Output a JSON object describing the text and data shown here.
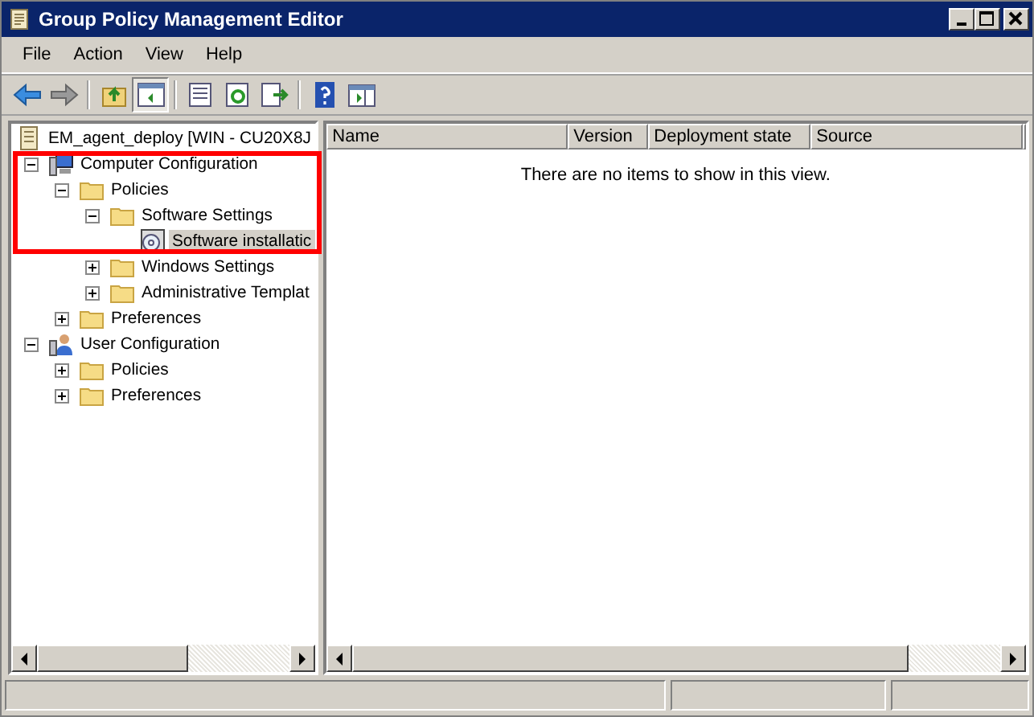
{
  "window": {
    "title": "Group Policy Management Editor"
  },
  "menu": [
    "File",
    "Action",
    "View",
    "Help"
  ],
  "toolbar": [
    {
      "kind": "back",
      "disabled": false
    },
    {
      "kind": "forward",
      "disabled": true
    },
    {
      "kind": "separator"
    },
    {
      "kind": "up"
    },
    {
      "kind": "tree",
      "pressed": true
    },
    {
      "kind": "separator"
    },
    {
      "kind": "properties"
    },
    {
      "kind": "refresh"
    },
    {
      "kind": "export"
    },
    {
      "kind": "separator"
    },
    {
      "kind": "help"
    },
    {
      "kind": "pane"
    }
  ],
  "tree": {
    "label": "EM_agent_deploy [WIN - CU20X8J",
    "kind": "document",
    "children": [
      {
        "label": "Computer Configuration",
        "kind": "computer",
        "expanded": true,
        "children": [
          {
            "label": "Policies",
            "kind": "folder",
            "expanded": true,
            "children": [
              {
                "label": "Software Settings",
                "kind": "folder",
                "expanded": true,
                "children": [
                  {
                    "label": "Software installatic",
                    "kind": "package",
                    "selected": true
                  }
                ]
              },
              {
                "label": "Windows Settings",
                "kind": "folder",
                "expanded": false
              },
              {
                "label": "Administrative Templat",
                "kind": "folder",
                "expanded": false
              }
            ]
          },
          {
            "label": "Preferences",
            "kind": "folder",
            "expanded": false
          }
        ]
      },
      {
        "label": "User Configuration",
        "kind": "user",
        "expanded": true,
        "children": [
          {
            "label": "Policies",
            "kind": "folder",
            "expanded": false
          },
          {
            "label": "Preferences",
            "kind": "folder",
            "expanded": false
          }
        ]
      }
    ]
  },
  "list": {
    "columns": [
      "Name",
      "Version",
      "Deployment state",
      "Source"
    ],
    "empty_message": "There are no items to show in this view."
  }
}
